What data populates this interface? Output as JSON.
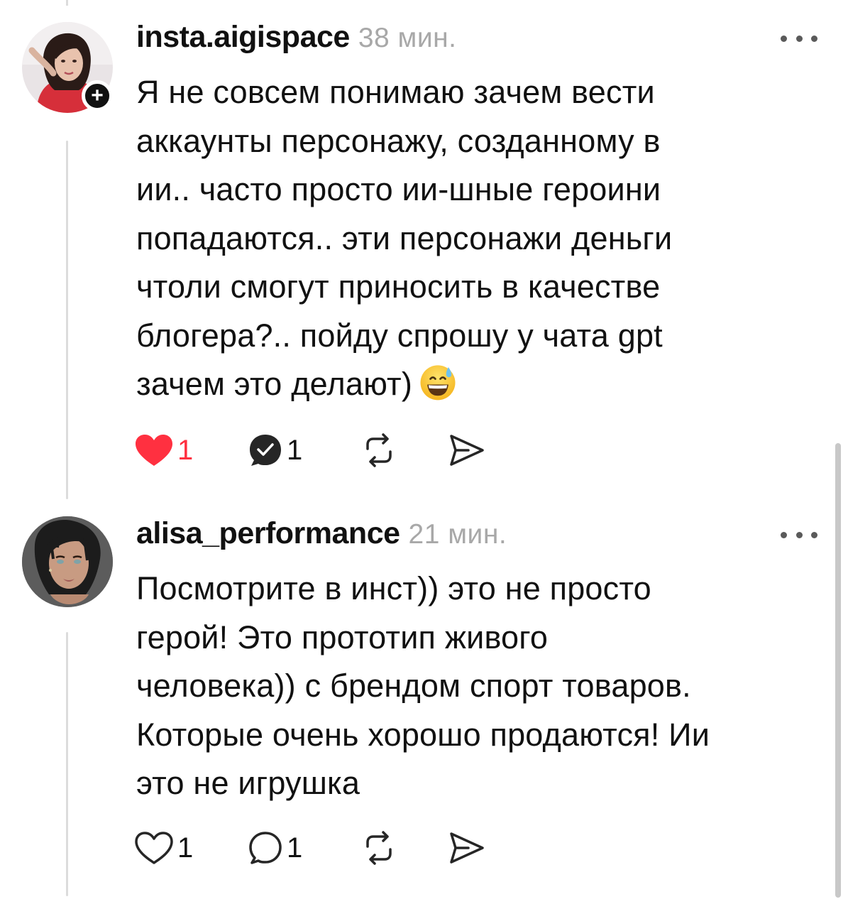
{
  "comments": [
    {
      "username": "insta.aigispace",
      "time": "38 мин.",
      "follow_badge": "+",
      "text_lines": [
        "Я не совсем понимаю зачем вести",
        "аккаунты персонажу, созданному в",
        "ии.. часто просто ии-шные героини",
        "попадаются.. эти персонажи деньги",
        "чтоли смогут приносить в качестве",
        "блогера?.. пойду спрошу у чата gpt",
        "зачем это делают)"
      ],
      "emoji": "grinning-face-with-sweat",
      "likes": "1",
      "liked": true,
      "replies": "1"
    },
    {
      "username": "alisa_performance",
      "time": "21 мин.",
      "text_lines": [
        "Посмотрите в инст)) это не просто",
        "герой! Это прототип живого",
        "человека)) с брендом спорт товаров.",
        "Которые очень хорошо продаются! Ии",
        "это не игрушка"
      ],
      "likes": "1",
      "liked": false,
      "replies": "1"
    }
  ],
  "colors": {
    "text": "#111111",
    "muted": "#a8a8a8",
    "like_red": "#ff3040",
    "thread_line": "#dcdcdc"
  },
  "icons": [
    "more-icon",
    "heart-icon",
    "reply-icon",
    "repost-icon",
    "share-icon"
  ]
}
